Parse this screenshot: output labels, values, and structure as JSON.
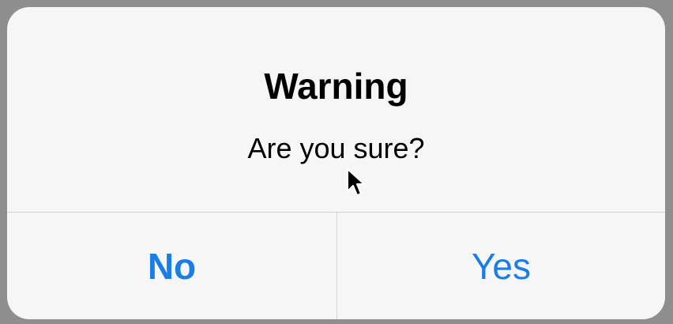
{
  "dialog": {
    "title": "Warning",
    "message": "Are you sure?",
    "buttons": {
      "no_label": "No",
      "yes_label": "Yes"
    }
  },
  "colors": {
    "backdrop": "#8e8e8e",
    "dialog_background": "#f6f6f6",
    "button_text": "#1a7ee6",
    "divider": "#d2d2d7"
  },
  "icons": {
    "cursor": "mouse-pointer-icon"
  }
}
